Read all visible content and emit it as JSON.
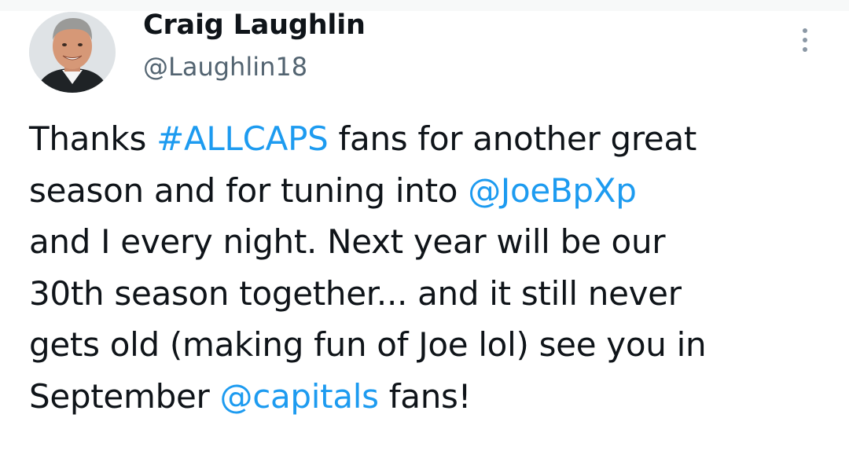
{
  "author": {
    "display_name": "Craig Laughlin",
    "handle": "@Laughlin18",
    "avatar_icon": "profile-photo"
  },
  "menu": {
    "icon": "more-vertical-icon"
  },
  "tweet": {
    "lines": [
      [
        {
          "text": "Thanks "
        },
        {
          "text": "#ALLCAPS",
          "link": true,
          "kind": "hashtag"
        },
        {
          "text": " fans for another great"
        }
      ],
      [
        {
          "text": "season and for tuning into "
        },
        {
          "text": "@JoeBpXp",
          "link": true,
          "kind": "mention"
        }
      ],
      [
        {
          "text": "and I every night. Next year will be our"
        }
      ],
      [
        {
          "text": "30th season together... and it still never"
        }
      ],
      [
        {
          "text": "gets old (making fun of Joe lol) see you in"
        }
      ],
      [
        {
          "text": "September "
        },
        {
          "text": "@capitals",
          "link": true,
          "kind": "mention"
        },
        {
          "text": " fans!"
        }
      ]
    ]
  },
  "colors": {
    "link": "#1d9bf0",
    "text": "#0f1419",
    "secondary": "#536471"
  }
}
